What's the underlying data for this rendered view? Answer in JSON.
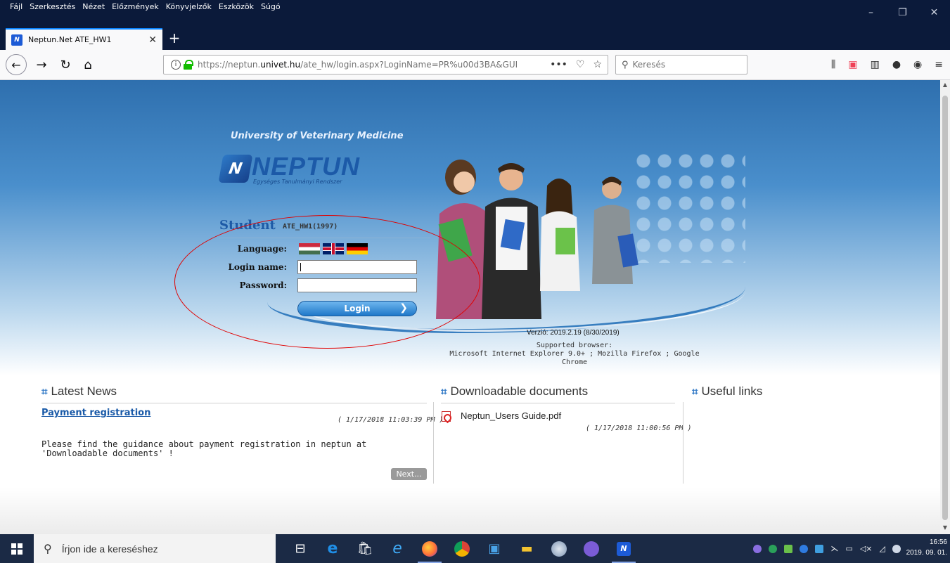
{
  "menubar": {
    "items": [
      "Fájl",
      "Szerkesztés",
      "Nézet",
      "Előzmények",
      "Könyvjelzők",
      "Eszközök",
      "Súgó"
    ]
  },
  "tab": {
    "title": "Neptun.Net ATE_HW1",
    "close": "✕"
  },
  "newtab": "+",
  "url": {
    "prefix": "https://neptun.",
    "domain": "univet.hu",
    "rest": "/ate_hw/login.aspx?LoginName=PR%u00d3BA&GUI",
    "actions": "•••"
  },
  "search": {
    "placeholder": "Keresés"
  },
  "page": {
    "university": "University of Veterinary Medicine",
    "logo_text": "NEPTUN",
    "logo_sub": "Egységes Tanulmányi Rendszer",
    "role": "Student",
    "role_code": "ATE_HW1(1997)",
    "language_label": "Language:",
    "login_label": "Login name:",
    "password_label": "Password:",
    "login_button": "Login",
    "version": "Verzió: 2019.2.19 (8/30/2019)",
    "supported_line1": "Supported browser:",
    "supported_line2": "Microsoft Internet Explorer 9.0+ ; Mozilla Firefox ; Google Chrome"
  },
  "news": {
    "title": "Latest News",
    "item_title": "Payment registration",
    "item_date": "( 1/17/2018 11:03:39 PM )",
    "item_body": " Please find the guidance about payment registration in neptun at 'Downloadable documents' !",
    "next": "Next..."
  },
  "documents": {
    "title": "Downloadable documents",
    "file_name": "Neptun_Users Guide.pdf",
    "file_date": "( 1/17/2018 11:00:56 PM )"
  },
  "links": {
    "title": "Useful links"
  },
  "taskbar": {
    "search_placeholder": "Írjon ide a kereséshez",
    "time": "16:56",
    "date": "2019. 09. 01."
  },
  "colors": {
    "accent": "#1d5aa6",
    "ellipse": "#e00000"
  }
}
